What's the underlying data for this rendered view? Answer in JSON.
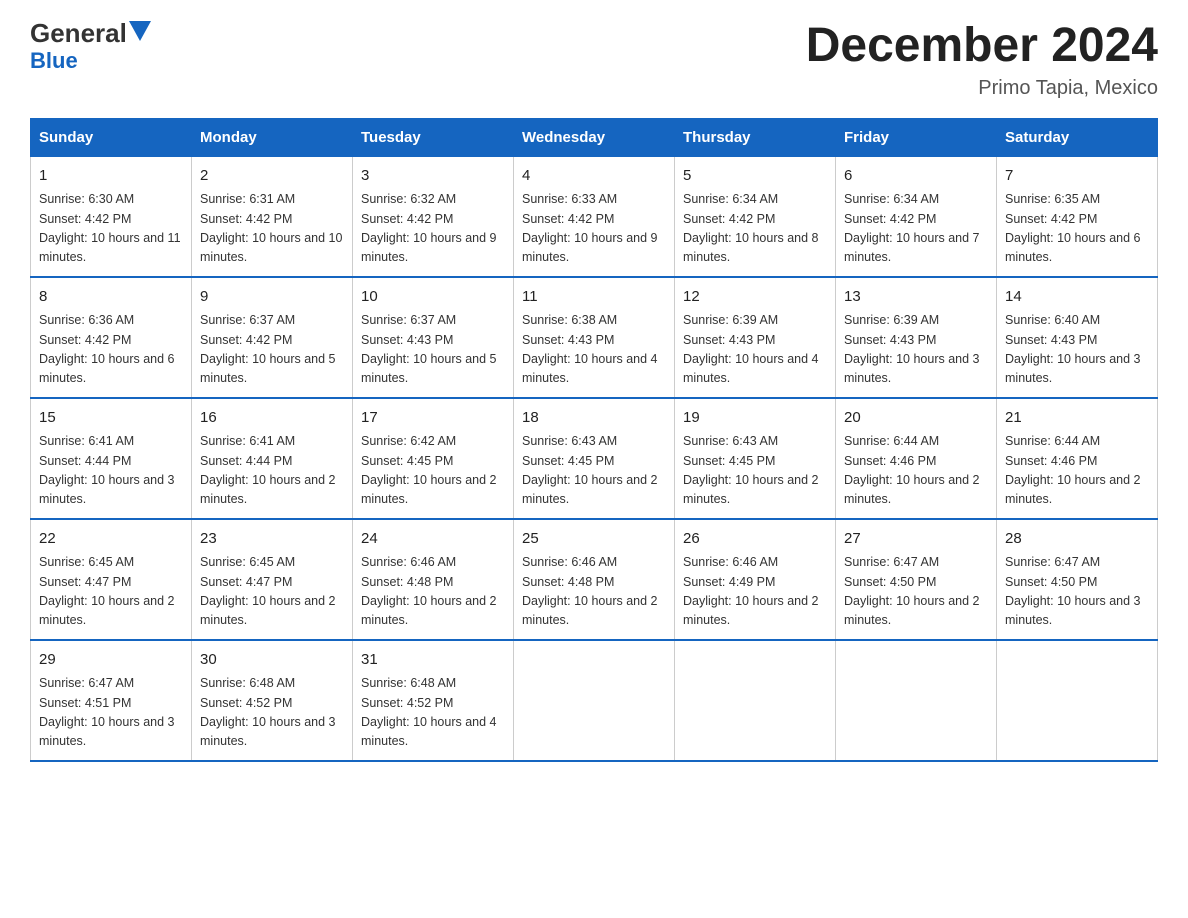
{
  "header": {
    "logo_main": "General",
    "logo_blue": "Blue",
    "month_title": "December 2024",
    "location": "Primo Tapia, Mexico"
  },
  "days_of_week": [
    "Sunday",
    "Monday",
    "Tuesday",
    "Wednesday",
    "Thursday",
    "Friday",
    "Saturday"
  ],
  "weeks": [
    [
      {
        "day": "1",
        "sunrise": "6:30 AM",
        "sunset": "4:42 PM",
        "daylight": "10 hours and 11 minutes."
      },
      {
        "day": "2",
        "sunrise": "6:31 AM",
        "sunset": "4:42 PM",
        "daylight": "10 hours and 10 minutes."
      },
      {
        "day": "3",
        "sunrise": "6:32 AM",
        "sunset": "4:42 PM",
        "daylight": "10 hours and 9 minutes."
      },
      {
        "day": "4",
        "sunrise": "6:33 AM",
        "sunset": "4:42 PM",
        "daylight": "10 hours and 9 minutes."
      },
      {
        "day": "5",
        "sunrise": "6:34 AM",
        "sunset": "4:42 PM",
        "daylight": "10 hours and 8 minutes."
      },
      {
        "day": "6",
        "sunrise": "6:34 AM",
        "sunset": "4:42 PM",
        "daylight": "10 hours and 7 minutes."
      },
      {
        "day": "7",
        "sunrise": "6:35 AM",
        "sunset": "4:42 PM",
        "daylight": "10 hours and 6 minutes."
      }
    ],
    [
      {
        "day": "8",
        "sunrise": "6:36 AM",
        "sunset": "4:42 PM",
        "daylight": "10 hours and 6 minutes."
      },
      {
        "day": "9",
        "sunrise": "6:37 AM",
        "sunset": "4:42 PM",
        "daylight": "10 hours and 5 minutes."
      },
      {
        "day": "10",
        "sunrise": "6:37 AM",
        "sunset": "4:43 PM",
        "daylight": "10 hours and 5 minutes."
      },
      {
        "day": "11",
        "sunrise": "6:38 AM",
        "sunset": "4:43 PM",
        "daylight": "10 hours and 4 minutes."
      },
      {
        "day": "12",
        "sunrise": "6:39 AM",
        "sunset": "4:43 PM",
        "daylight": "10 hours and 4 minutes."
      },
      {
        "day": "13",
        "sunrise": "6:39 AM",
        "sunset": "4:43 PM",
        "daylight": "10 hours and 3 minutes."
      },
      {
        "day": "14",
        "sunrise": "6:40 AM",
        "sunset": "4:43 PM",
        "daylight": "10 hours and 3 minutes."
      }
    ],
    [
      {
        "day": "15",
        "sunrise": "6:41 AM",
        "sunset": "4:44 PM",
        "daylight": "10 hours and 3 minutes."
      },
      {
        "day": "16",
        "sunrise": "6:41 AM",
        "sunset": "4:44 PM",
        "daylight": "10 hours and 2 minutes."
      },
      {
        "day": "17",
        "sunrise": "6:42 AM",
        "sunset": "4:45 PM",
        "daylight": "10 hours and 2 minutes."
      },
      {
        "day": "18",
        "sunrise": "6:43 AM",
        "sunset": "4:45 PM",
        "daylight": "10 hours and 2 minutes."
      },
      {
        "day": "19",
        "sunrise": "6:43 AM",
        "sunset": "4:45 PM",
        "daylight": "10 hours and 2 minutes."
      },
      {
        "day": "20",
        "sunrise": "6:44 AM",
        "sunset": "4:46 PM",
        "daylight": "10 hours and 2 minutes."
      },
      {
        "day": "21",
        "sunrise": "6:44 AM",
        "sunset": "4:46 PM",
        "daylight": "10 hours and 2 minutes."
      }
    ],
    [
      {
        "day": "22",
        "sunrise": "6:45 AM",
        "sunset": "4:47 PM",
        "daylight": "10 hours and 2 minutes."
      },
      {
        "day": "23",
        "sunrise": "6:45 AM",
        "sunset": "4:47 PM",
        "daylight": "10 hours and 2 minutes."
      },
      {
        "day": "24",
        "sunrise": "6:46 AM",
        "sunset": "4:48 PM",
        "daylight": "10 hours and 2 minutes."
      },
      {
        "day": "25",
        "sunrise": "6:46 AM",
        "sunset": "4:48 PM",
        "daylight": "10 hours and 2 minutes."
      },
      {
        "day": "26",
        "sunrise": "6:46 AM",
        "sunset": "4:49 PM",
        "daylight": "10 hours and 2 minutes."
      },
      {
        "day": "27",
        "sunrise": "6:47 AM",
        "sunset": "4:50 PM",
        "daylight": "10 hours and 2 minutes."
      },
      {
        "day": "28",
        "sunrise": "6:47 AM",
        "sunset": "4:50 PM",
        "daylight": "10 hours and 3 minutes."
      }
    ],
    [
      {
        "day": "29",
        "sunrise": "6:47 AM",
        "sunset": "4:51 PM",
        "daylight": "10 hours and 3 minutes."
      },
      {
        "day": "30",
        "sunrise": "6:48 AM",
        "sunset": "4:52 PM",
        "daylight": "10 hours and 3 minutes."
      },
      {
        "day": "31",
        "sunrise": "6:48 AM",
        "sunset": "4:52 PM",
        "daylight": "10 hours and 4 minutes."
      },
      null,
      null,
      null,
      null
    ]
  ]
}
